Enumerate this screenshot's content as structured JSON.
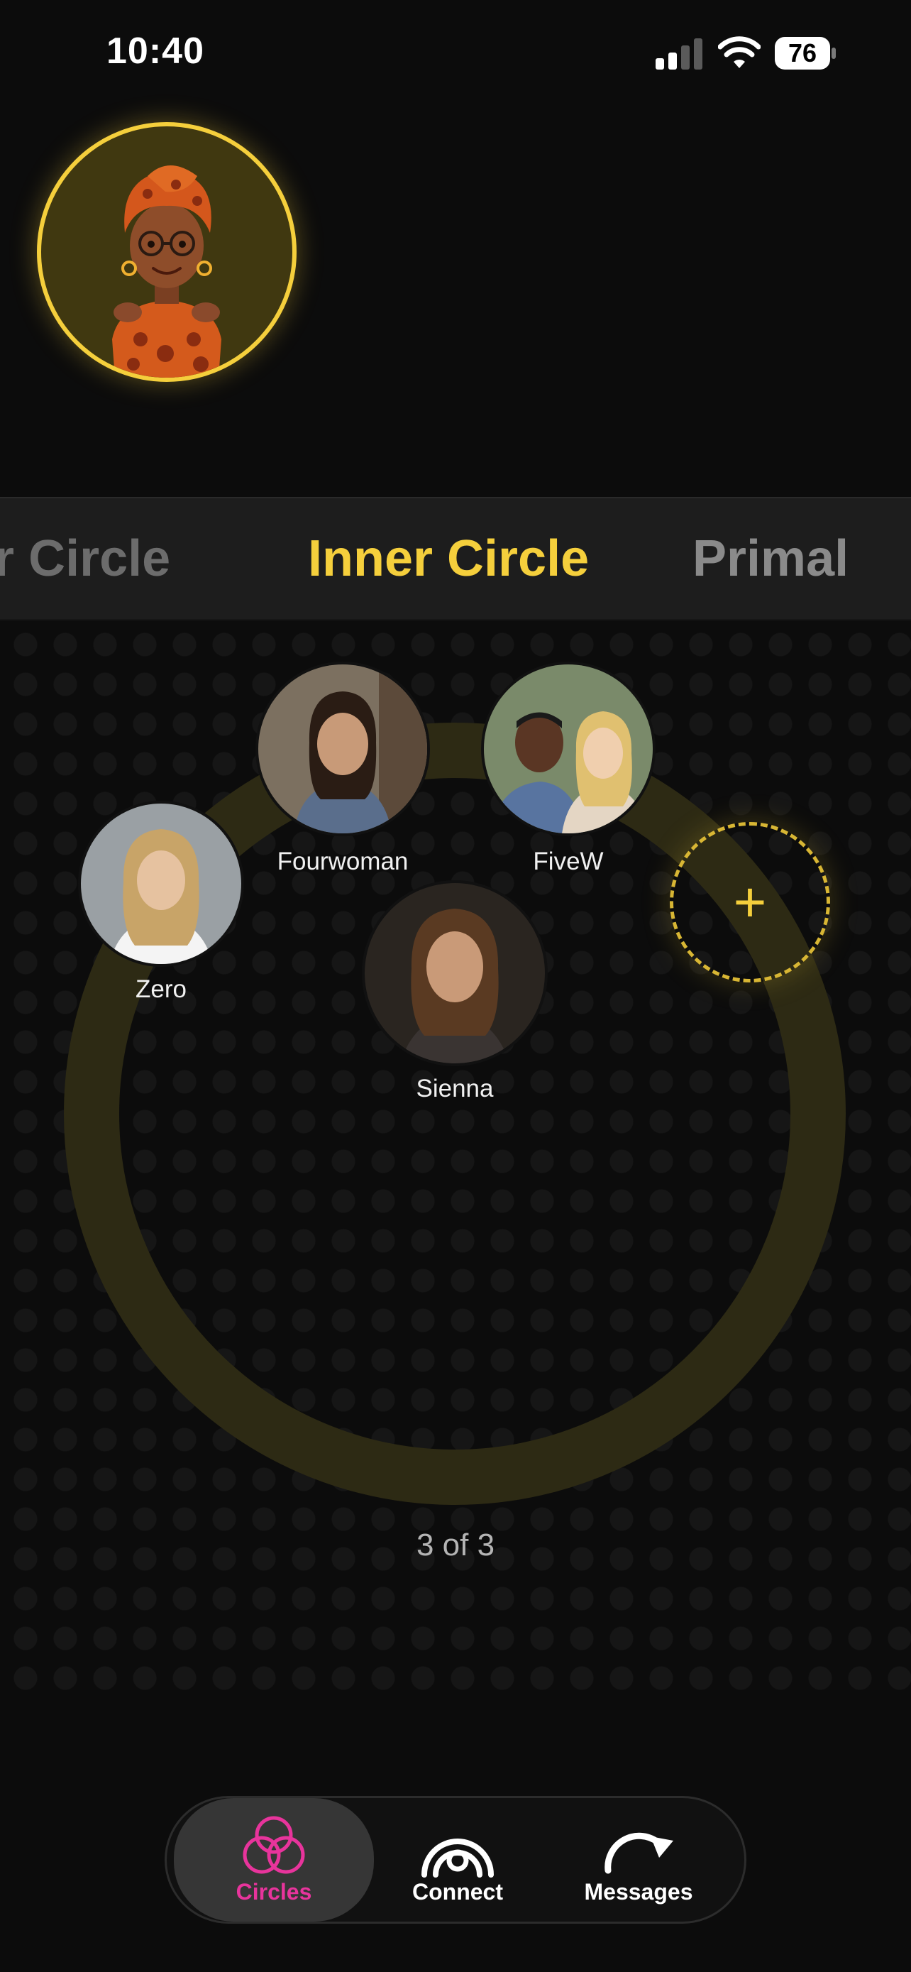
{
  "status_bar": {
    "time": "10:40",
    "battery": "76"
  },
  "tabs": [
    {
      "label": "er Circle"
    },
    {
      "label": "Inner Circle"
    },
    {
      "label": "Primal"
    }
  ],
  "members": [
    {
      "name": "Fourwoman"
    },
    {
      "name": "FiveW"
    },
    {
      "name": "Zero"
    },
    {
      "name": "Sienna"
    }
  ],
  "add_button": {
    "label": "+"
  },
  "counter": "3 of 3",
  "nav": [
    {
      "label": "Circles",
      "icon": "circles-icon",
      "active": true
    },
    {
      "label": "Connect",
      "icon": "connect-icon",
      "active": false
    },
    {
      "label": "Messages",
      "icon": "messages-icon",
      "active": false
    }
  ],
  "colors": {
    "accent": "#f5cf3c",
    "active_nav": "#e8349c",
    "background": "#0c0c0c",
    "ring": "#2d2a14"
  }
}
